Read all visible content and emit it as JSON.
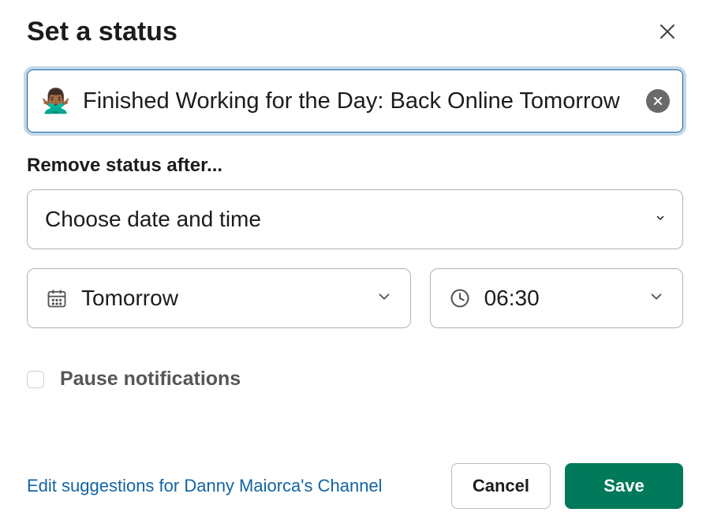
{
  "dialog": {
    "title": "Set a status"
  },
  "status": {
    "emoji": "🙅🏾‍♂️",
    "text": "Finished Working for the Day: Back Online Tomorrow"
  },
  "remove_after": {
    "label": "Remove status after...",
    "mode_label": "Choose date and time",
    "date_label": "Tomorrow",
    "time_label": "06:30"
  },
  "pause": {
    "label": "Pause notifications",
    "checked": false
  },
  "footer": {
    "edit_link": "Edit suggestions for Danny Maiorca's Channel",
    "cancel_label": "Cancel",
    "save_label": "Save"
  }
}
